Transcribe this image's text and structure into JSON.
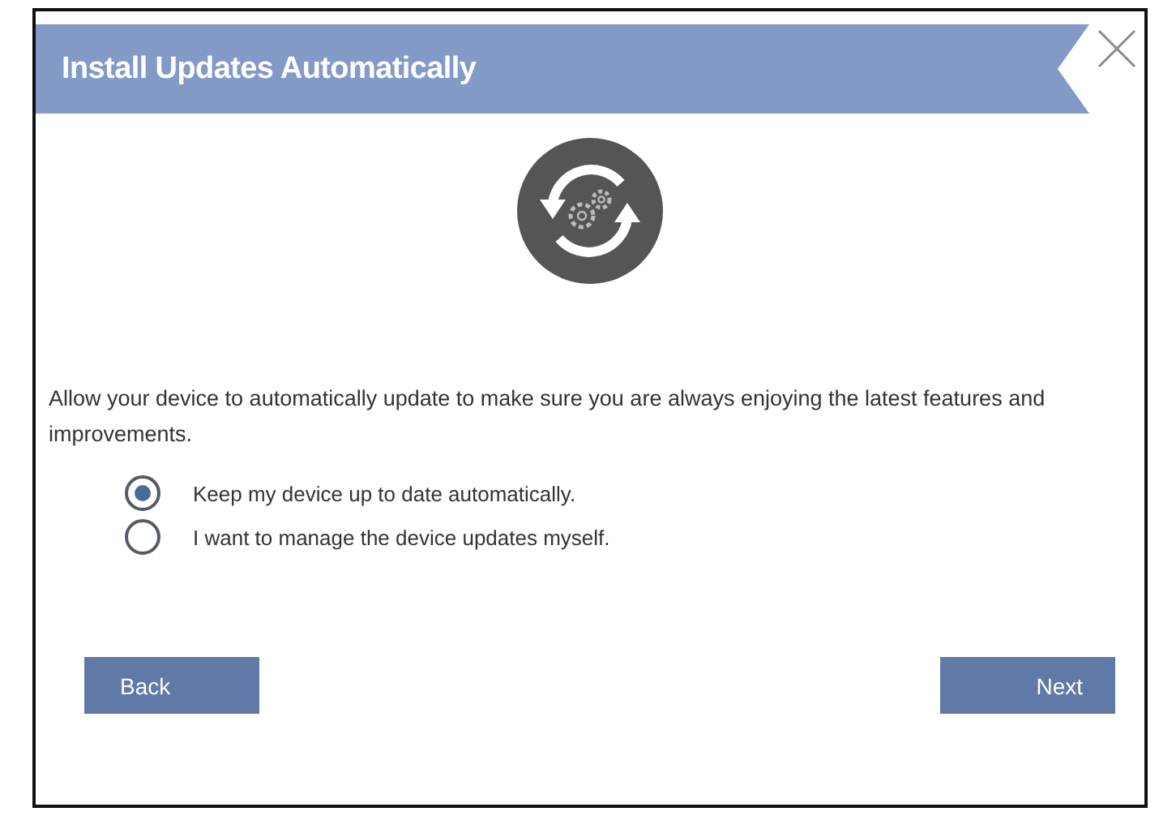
{
  "dialog": {
    "title": "Install Updates Automatically"
  },
  "description": "Allow your device to automatically update to make sure you are always enjoying the latest features and improvements.",
  "options": [
    {
      "label": "Keep my device up to date automatically.",
      "selected": true
    },
    {
      "label": "I want to manage the device updates myself.",
      "selected": false
    }
  ],
  "buttons": [
    {
      "label": "Back",
      "kind": "back"
    },
    {
      "label": "Next",
      "kind": "next"
    }
  ]
}
